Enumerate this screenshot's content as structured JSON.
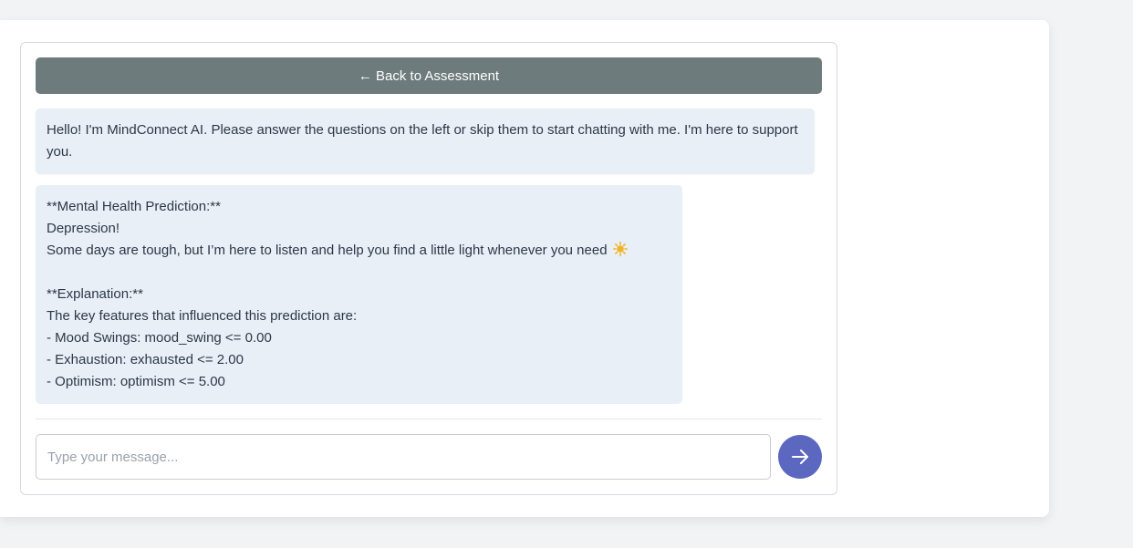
{
  "chat": {
    "back_button_label": "← Back to Assessment",
    "messages": [
      {
        "text": "Hello! I'm MindConnect AI. Please answer the questions on the left or skip them to start chatting with me. I'm here to support you."
      },
      {
        "lines": [
          "**Mental Health Prediction:**",
          "Depression!",
          "Some days are tough, but I’m here to listen and help you find a little light whenever you need",
          "",
          "**Explanation:**",
          "The key features that influenced this prediction are:",
          "- Mood Swings: mood_swing <= 0.00",
          "- Exhaustion: exhausted <= 2.00",
          "- Optimism: optimism <= 5.00"
        ],
        "emoji_icon": "sun-icon"
      }
    ],
    "input": {
      "placeholder": "Type your message...",
      "value": ""
    },
    "send_icon": "arrow-right-icon"
  },
  "colors": {
    "page_background": "#f2f3f5",
    "back_button": "#6e7b7c",
    "message_bubble": "#e8eff6",
    "send_button": "#5c67c0",
    "sun": "#f0b429"
  }
}
